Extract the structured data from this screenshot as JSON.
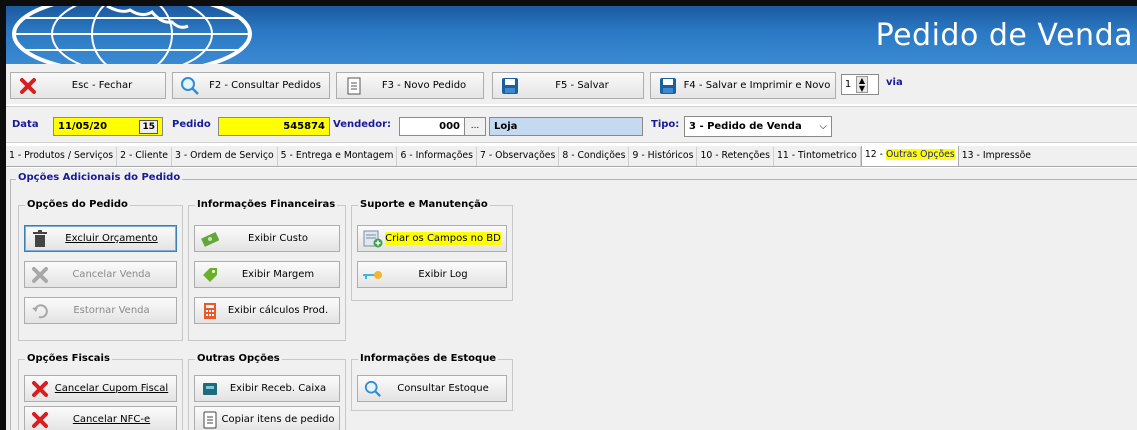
{
  "header": {
    "title": "Pedido de Venda"
  },
  "toolbar": {
    "close_label": "Esc - Fechar",
    "consult_label": "F2 - Consultar Pedidos",
    "new_label": "F3 - Novo Pedido",
    "save_label": "F5 - Salvar",
    "save_print_label": "F4 - Salvar e Imprimir e Novo",
    "copies_value": "1",
    "copies_suffix": "via"
  },
  "order": {
    "date_label": "Data",
    "date_value": "11/05/20",
    "order_label": "Pedido",
    "order_value": "545874",
    "seller_label": "Vendedor:",
    "seller_code": "000",
    "seller_browse": "...",
    "seller_name": "Loja",
    "type_label": "Tipo:",
    "type_value": "3 - Pedido de Venda"
  },
  "tabs": [
    {
      "label": "1 - Produtos / Serviços"
    },
    {
      "label": "2 - Cliente"
    },
    {
      "label": "3 - Ordem de Serviço"
    },
    {
      "label": "5 - Entrega e Montagem"
    },
    {
      "label": "6 - Informações"
    },
    {
      "label": "7 - Observações"
    },
    {
      "label": "8 - Condições"
    },
    {
      "label": "9 - Históricos"
    },
    {
      "label": "10 - Retenções"
    },
    {
      "label": "11 - Tintometrico"
    },
    {
      "label_prefix": "12 - ",
      "label_hl": "Outras Opções"
    },
    {
      "label": "13 - Impressõe"
    }
  ],
  "content": {
    "section_title": "Opções Adicionais do Pedido",
    "groups": {
      "pedido": {
        "title": "Opções do Pedido",
        "buttons": [
          "Excluir Orçamento",
          "Cancelar Venda",
          "Estornar Venda"
        ]
      },
      "financeiras": {
        "title": "Informações Financeiras",
        "buttons": [
          "Exibir Custo",
          "Exibir Margem",
          "Exibir cálculos Prod."
        ]
      },
      "suporte": {
        "title": "Suporte e Manutenção",
        "buttons": [
          "Criar os Campos no BD",
          "Exibir Log"
        ]
      },
      "fiscais": {
        "title": "Opções Fiscais",
        "buttons": [
          "Cancelar Cupom Fiscal",
          "Cancelar NFC-e"
        ]
      },
      "outras": {
        "title": "Outras Opções",
        "buttons": [
          "Exibir Receb. Caixa",
          "Copiar itens de pedido"
        ]
      },
      "estoque": {
        "title": "Informações de Estoque",
        "buttons": [
          "Consultar Estoque"
        ]
      }
    }
  },
  "colors": {
    "banner": "#2b79c4",
    "highlight": "#ffff00",
    "label_blue": "#1a1a99",
    "field_blue": "#c5d9f1"
  },
  "icons": [
    "globe-logo",
    "close-icon",
    "search-icon",
    "new-document-icon",
    "save-icon",
    "save-print-icon",
    "trash-icon",
    "cancel-icon",
    "undo-icon",
    "money-icon",
    "tag-icon",
    "calculator-icon",
    "database-add-icon",
    "key-icon",
    "cash-register-icon",
    "copy-document-icon"
  ]
}
